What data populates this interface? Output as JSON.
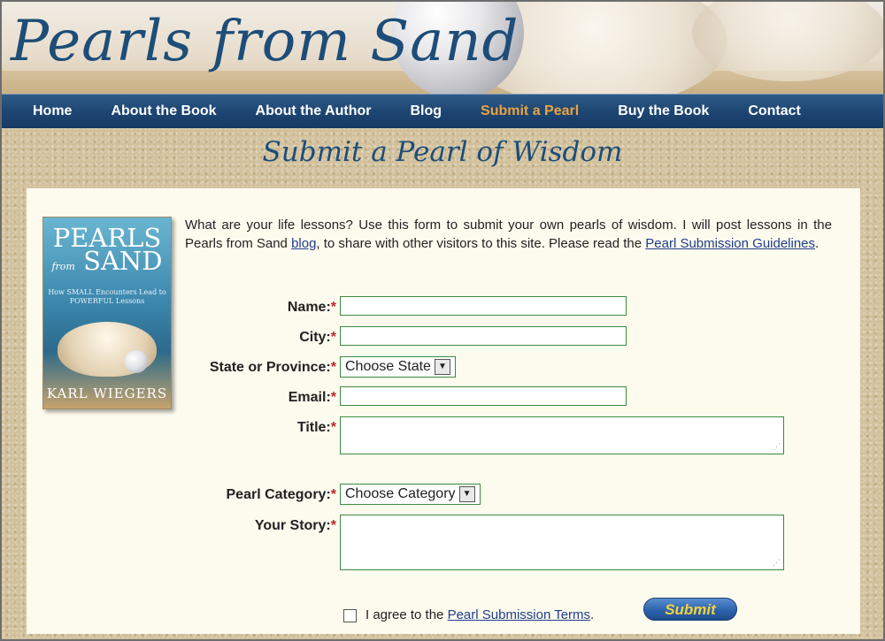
{
  "site": {
    "title": "Pearls from Sand"
  },
  "nav": {
    "items": [
      {
        "label": "Home",
        "active": false
      },
      {
        "label": "About the Book",
        "active": false
      },
      {
        "label": "About the Author",
        "active": false
      },
      {
        "label": "Blog",
        "active": false
      },
      {
        "label": "Submit a Pearl",
        "active": true
      },
      {
        "label": "Buy the Book",
        "active": false
      },
      {
        "label": "Contact",
        "active": false
      }
    ]
  },
  "page": {
    "heading": "Submit a Pearl of Wisdom"
  },
  "book": {
    "title_line1": "PEARLS",
    "title_from": "from",
    "title_line2": "SAND",
    "subtitle": "How SMALL Encounters Lead to POWERFUL Lessons",
    "author": "KARL WIEGERS"
  },
  "intro": {
    "text_before_blog": "What are your life lessons? Use this form to submit your own pearls of wisdom. I will post lessons in the Pearls from Sand ",
    "blog_link": "blog",
    "text_after_blog": ", to share with other visitors to this site. Please read the ",
    "guidelines_link": "Pearl Submission Guidelines",
    "text_end": "."
  },
  "form": {
    "required_mark": "*",
    "name_label": "Name:",
    "name_value": "",
    "city_label": "City:",
    "city_value": "",
    "state_label": "State or Province:",
    "state_selected": "Choose State",
    "email_label": "Email:",
    "email_value": "",
    "title_label": "Title:",
    "title_value": "",
    "category_label": "Pearl Category:",
    "category_selected": "Choose Category",
    "story_label": "Your Story:",
    "story_value": "",
    "agree_text": "I agree to the ",
    "terms_link": "Pearl Submission Terms",
    "agree_end": ".",
    "agree_checked": false,
    "submit_label": "Submit"
  },
  "colors": {
    "nav_background": "#1e4673",
    "nav_active": "#e8a441",
    "heading": "#1d4d78",
    "required": "#c0262e",
    "submit_text": "#f2d33a",
    "panel": "#fdfbee"
  }
}
